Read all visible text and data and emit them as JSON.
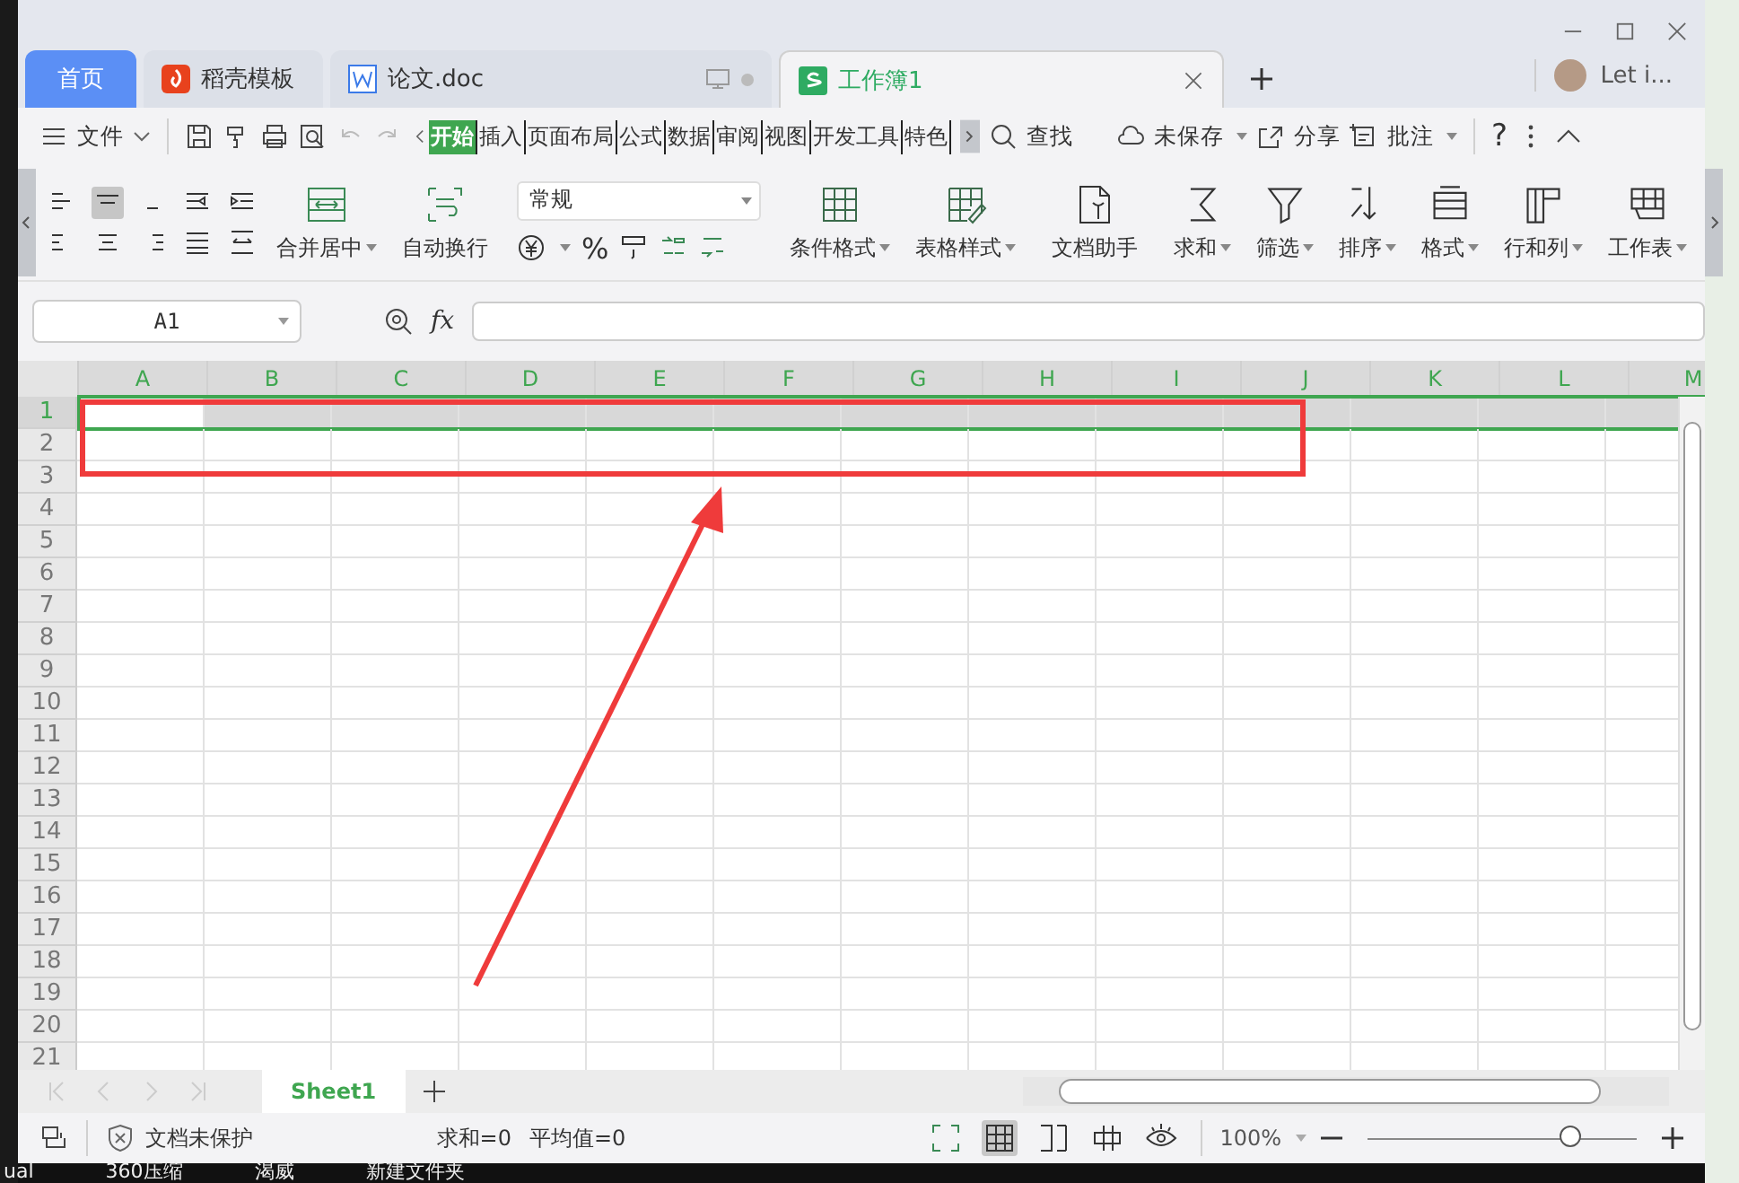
{
  "window_tabs": [
    {
      "label": "首页",
      "kind": "home",
      "selected": false
    },
    {
      "label": "稻壳模板",
      "kind": "docer",
      "selected": false
    },
    {
      "label": "论文.doc",
      "kind": "word",
      "selected": false
    },
    {
      "label": "工作簿1",
      "kind": "sheet",
      "selected": true
    }
  ],
  "user": {
    "name": "Let i..."
  },
  "menu": {
    "file": "文件",
    "tabs": [
      {
        "label": "开始",
        "selected": true
      },
      {
        "label": "插入",
        "selected": false
      },
      {
        "label": "页面布局",
        "selected": false
      },
      {
        "label": "公式",
        "selected": false
      },
      {
        "label": "数据",
        "selected": false
      },
      {
        "label": "审阅",
        "selected": false
      },
      {
        "label": "视图",
        "selected": false
      },
      {
        "label": "开发工具",
        "selected": false
      },
      {
        "label": "特色",
        "selected": false
      }
    ],
    "search": "查找",
    "actions": [
      {
        "label": "未保存",
        "dropdown": true
      },
      {
        "label": "分享",
        "dropdown": false
      },
      {
        "label": "批注",
        "dropdown": true
      }
    ],
    "help": "?"
  },
  "ribbon": {
    "align_selected": [
      false,
      true,
      false,
      false,
      false,
      false,
      false,
      false,
      false,
      false
    ],
    "merge": [
      {
        "label": "合并居中",
        "dropdown": true
      },
      {
        "label": "自动换行",
        "dropdown": false
      }
    ],
    "number_format": "常规",
    "percent": "%",
    "format_groups": [
      {
        "label": "条件格式",
        "dropdown": true
      },
      {
        "label": "表格样式",
        "dropdown": true
      }
    ],
    "assistant": "文档助手",
    "tools": [
      {
        "label": "求和",
        "dropdown": true
      },
      {
        "label": "筛选",
        "dropdown": true
      },
      {
        "label": "排序",
        "dropdown": true
      },
      {
        "label": "格式",
        "dropdown": true
      },
      {
        "label": "行和列",
        "dropdown": true
      },
      {
        "label": "工作表",
        "dropdown": true
      }
    ]
  },
  "formula_bar": {
    "cell_ref": "A1",
    "fx": "fx"
  },
  "grid": {
    "columns": [
      {
        "label": "A",
        "selected": true
      },
      {
        "label": "B",
        "selected": true
      },
      {
        "label": "C",
        "selected": true
      },
      {
        "label": "D",
        "selected": true
      },
      {
        "label": "E",
        "selected": true
      },
      {
        "label": "F",
        "selected": true
      },
      {
        "label": "G",
        "selected": true
      },
      {
        "label": "H",
        "selected": true
      },
      {
        "label": "I",
        "selected": true
      },
      {
        "label": "J",
        "selected": true
      },
      {
        "label": "K",
        "selected": true
      },
      {
        "label": "L",
        "selected": true
      },
      {
        "label": "M",
        "selected": true
      }
    ],
    "rows": [
      {
        "label": "1",
        "selected": true
      },
      {
        "label": "2",
        "selected": false
      },
      {
        "label": "3",
        "selected": false
      },
      {
        "label": "4",
        "selected": false
      },
      {
        "label": "5",
        "selected": false
      },
      {
        "label": "6",
        "selected": false
      },
      {
        "label": "7",
        "selected": false
      },
      {
        "label": "8",
        "selected": false
      },
      {
        "label": "9",
        "selected": false
      },
      {
        "label": "10",
        "selected": false
      },
      {
        "label": "11",
        "selected": false
      },
      {
        "label": "12",
        "selected": false
      },
      {
        "label": "13",
        "selected": false
      },
      {
        "label": "14",
        "selected": false
      },
      {
        "label": "15",
        "selected": false
      },
      {
        "label": "16",
        "selected": false
      },
      {
        "label": "17",
        "selected": false
      },
      {
        "label": "18",
        "selected": false
      },
      {
        "label": "19",
        "selected": false
      },
      {
        "label": "20",
        "selected": false
      },
      {
        "label": "21",
        "selected": false
      }
    ]
  },
  "sheets": [
    {
      "label": "Sheet1",
      "selected": true
    }
  ],
  "status_bar": {
    "protection": "文档未保护",
    "stats": [
      "求和=0",
      "平均值=0"
    ],
    "view_selected": [
      false,
      true,
      false,
      false,
      false
    ],
    "zoom": "100%",
    "zoom_level": {
      "level": 0.75
    }
  },
  "taskbar": [
    "ual",
    "360压缩",
    "渴威",
    "新建文件夹"
  ]
}
